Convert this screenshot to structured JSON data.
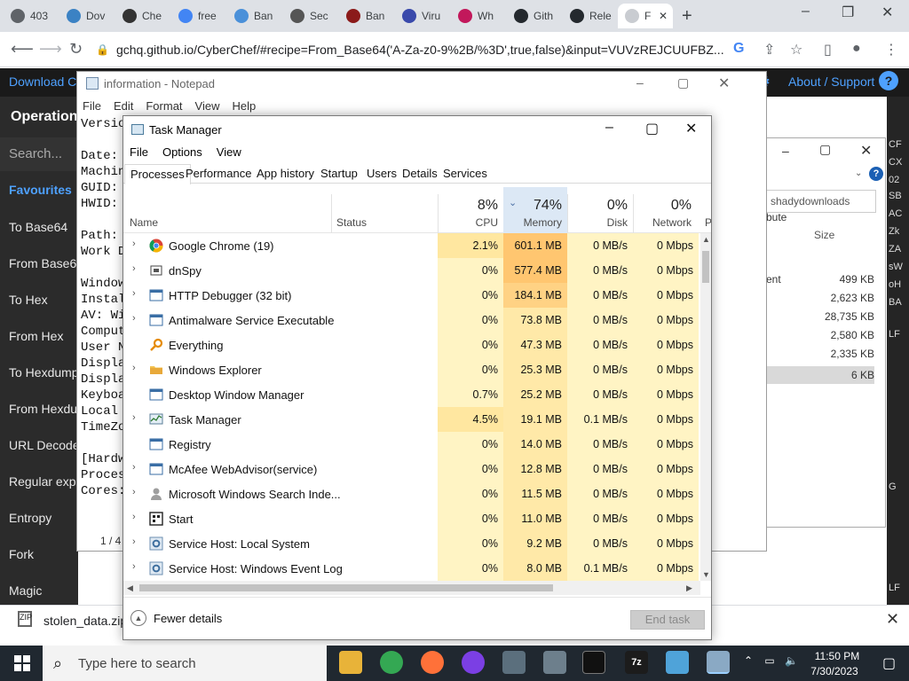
{
  "browser": {
    "tabs": [
      {
        "label": "403",
        "color": "#5f6368"
      },
      {
        "label": "Dov",
        "color": "#3b82c4"
      },
      {
        "label": "Che",
        "color": "#333333"
      },
      {
        "label": "free",
        "color": "#4285f4"
      },
      {
        "label": "Ban",
        "color": "#4a90d9"
      },
      {
        "label": "Sec",
        "color": "#555555"
      },
      {
        "label": "Ban",
        "color": "#8b1a1a"
      },
      {
        "label": "Viru",
        "color": "#3949ab"
      },
      {
        "label": "Wh",
        "color": "#c2185b"
      },
      {
        "label": "Gith",
        "color": "#24292e"
      },
      {
        "label": "Rele",
        "color": "#24292e"
      }
    ],
    "active_tab": {
      "label": "F",
      "close": "✕"
    },
    "new_tab": "+",
    "window_controls": {
      "minimize": "–",
      "maximize": "❐",
      "close": "✕"
    },
    "url": "gchq.github.io/CyberChef/#recipe=From_Base64('A-Za-z0-9%2B/%3D',true,false)&input=VUVzREJCUUFBZ..."
  },
  "cyberchef": {
    "download": "Download C",
    "about": "About / Support",
    "help": "?",
    "operations_title": "Operation",
    "search": "Search...",
    "favourites": "Favourites",
    "operations": [
      "To Base64",
      "From Base6",
      "To Hex",
      "From Hex",
      "To Hexdump",
      "From Hexdu",
      "URL Decode",
      "Regular exp",
      "Entropy",
      "Fork",
      "Magic"
    ],
    "right_glyphs": [
      "CF",
      "CX",
      "02",
      "SB",
      "AC",
      "Zk",
      "ZA",
      "sW",
      "oH",
      "BA",
      "LF",
      "G",
      "LF"
    ]
  },
  "explorer": {
    "search_placeholder": "shadydownloads",
    "col_size": "Size",
    "col_attr": "bute",
    "item_fragment": "ent",
    "sizes": [
      "499 KB",
      "2,623 KB",
      "28,735 KB",
      "2,580 KB",
      "2,335 KB",
      "6 KB"
    ]
  },
  "notepad": {
    "title": "information - Notepad",
    "menu": [
      "File",
      "Edit",
      "Format",
      "View",
      "Help"
    ],
    "lines": [
      "Versio",
      "",
      "Date:",
      "Machin",
      "GUID:",
      "HWID:",
      "",
      "Path:",
      "Work D",
      "",
      "Window",
      "Instal",
      "AV: Wi",
      "Comput",
      "User N",
      "Displa",
      "Displa",
      "Keyboa",
      "Local",
      "TimeZo",
      "",
      "[Hardw",
      "Proces",
      "Cores:"
    ],
    "status": "1 / 4"
  },
  "download_bar": {
    "file": "stolen_data.zip",
    "icon": "ZIP"
  },
  "task_manager": {
    "title": "Task Manager",
    "menu": [
      "File",
      "Options",
      "View"
    ],
    "tabs": [
      "Processes",
      "Performance",
      "App history",
      "Startup",
      "Users",
      "Details",
      "Services"
    ],
    "columns": {
      "name": "Name",
      "status": "Status",
      "cpu": {
        "pct": "8%",
        "label": "CPU"
      },
      "memory": {
        "pct": "74%",
        "label": "Memory"
      },
      "disk": {
        "pct": "0%",
        "label": "Disk"
      },
      "network": {
        "pct": "0%",
        "label": "Network"
      },
      "power": "P"
    },
    "processes": [
      {
        "name": "Google Chrome (19)",
        "expandable": true,
        "icon": "chrome",
        "cpu": "2.1%",
        "memory": "601.1 MB",
        "disk": "0 MB/s",
        "network": "0 Mbps"
      },
      {
        "name": "dnSpy",
        "expandable": true,
        "icon": "window",
        "cpu": "0%",
        "memory": "577.4 MB",
        "disk": "0 MB/s",
        "network": "0 Mbps"
      },
      {
        "name": "HTTP Debugger (32 bit)",
        "expandable": true,
        "icon": "app",
        "cpu": "0%",
        "memory": "184.1 MB",
        "disk": "0 MB/s",
        "network": "0 Mbps"
      },
      {
        "name": "Antimalware Service Executable",
        "expandable": true,
        "icon": "app",
        "cpu": "0%",
        "memory": "73.8 MB",
        "disk": "0 MB/s",
        "network": "0 Mbps"
      },
      {
        "name": "Everything",
        "expandable": false,
        "icon": "search",
        "cpu": "0%",
        "memory": "47.3 MB",
        "disk": "0 MB/s",
        "network": "0 Mbps"
      },
      {
        "name": "Windows Explorer",
        "expandable": true,
        "icon": "folder",
        "cpu": "0%",
        "memory": "25.3 MB",
        "disk": "0 MB/s",
        "network": "0 Mbps"
      },
      {
        "name": "Desktop Window Manager",
        "expandable": false,
        "icon": "app",
        "cpu": "0.7%",
        "memory": "25.2 MB",
        "disk": "0 MB/s",
        "network": "0 Mbps"
      },
      {
        "name": "Task Manager",
        "expandable": true,
        "icon": "taskmgr",
        "cpu": "4.5%",
        "memory": "19.1 MB",
        "disk": "0.1 MB/s",
        "network": "0 Mbps"
      },
      {
        "name": "Registry",
        "expandable": false,
        "icon": "app",
        "cpu": "0%",
        "memory": "14.0 MB",
        "disk": "0 MB/s",
        "network": "0 Mbps"
      },
      {
        "name": "McAfee WebAdvisor(service)",
        "expandable": true,
        "icon": "app",
        "cpu": "0%",
        "memory": "12.8 MB",
        "disk": "0 MB/s",
        "network": "0 Mbps"
      },
      {
        "name": "Microsoft Windows Search Inde...",
        "expandable": true,
        "icon": "person",
        "cpu": "0%",
        "memory": "11.5 MB",
        "disk": "0 MB/s",
        "network": "0 Mbps"
      },
      {
        "name": "Start",
        "expandable": true,
        "icon": "start",
        "cpu": "0%",
        "memory": "11.0 MB",
        "disk": "0 MB/s",
        "network": "0 Mbps"
      },
      {
        "name": "Service Host: Local System",
        "expandable": true,
        "icon": "gear",
        "cpu": "0%",
        "memory": "9.2 MB",
        "disk": "0 MB/s",
        "network": "0 Mbps"
      },
      {
        "name": "Service Host: Windows Event Log",
        "expandable": true,
        "icon": "gear",
        "cpu": "0%",
        "memory": "8.0 MB",
        "disk": "0.1 MB/s",
        "network": "0 Mbps"
      }
    ],
    "fewer_details": "Fewer details",
    "end_task": "End task"
  },
  "taskbar": {
    "search_placeholder": "Type here to search",
    "time": "11:50 PM",
    "date": "7/30/2023"
  },
  "colors": {
    "cpu_cell": "#fff4c4",
    "mem_cell_light": "#ffe9a8",
    "mem_cell_high": "#ffd284",
    "mem_cell_higher": "#ffc670",
    "cpu_cell_warm": "#ffe7a0",
    "header_sort": "#dce8f5"
  }
}
